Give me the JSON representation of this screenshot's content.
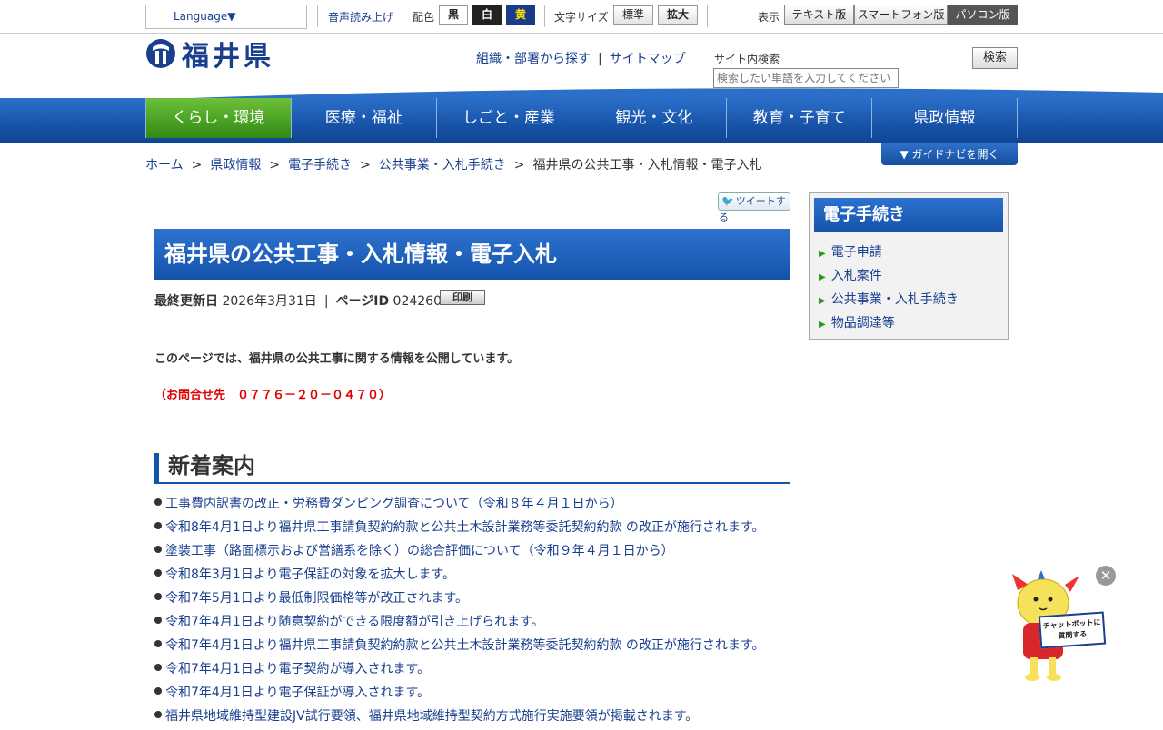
{
  "topbar": {
    "language": "Language▼",
    "read_aloud": "音声読み上げ",
    "color_label": "配色",
    "color_black": "黒",
    "color_white": "白",
    "color_yellow": "黄",
    "font_size_label": "文字サイズ",
    "font_standard": "標準",
    "font_large": "拡大",
    "display_label": "表示",
    "display_text": "テキスト版",
    "display_smartphone": "スマートフォン版",
    "display_pc": "パソコン版"
  },
  "header": {
    "logo_text": "福井県",
    "org_link": "組織・部署から探す",
    "separator": "|",
    "sitemap_link": "サイトマップ",
    "search_label": "サイト内検索",
    "search_placeholder": "検索したい単語を入力してください",
    "search_button": "検索"
  },
  "nav": [
    "くらし・環境",
    "医療・福祉",
    "しごと・産業",
    "観光・文化",
    "教育・子育て",
    "県政情報"
  ],
  "guide_button": "▼ ガイドナビを開く",
  "breadcrumb": [
    "ホーム",
    "県政情報",
    "電子手続き",
    "公共事業・入札手続き",
    "福井県の公共工事・入札情報・電子入札"
  ],
  "breadcrumb_sep": ">",
  "main": {
    "tweet": "ツイートする",
    "title": "福井県の公共工事・入札情報・電子入札",
    "updated_label": "最終更新日",
    "updated_value": "2026年3月31日",
    "meta_sep": "|",
    "page_id_label": "ページID",
    "page_id_value": "024260",
    "print_button": "印刷",
    "intro": "このページでは、福井県の公共工事に関する情報を公開しています。",
    "contact": "（お問合せ先　０７７６－２０－０４７０）",
    "section_heading": "新着案内",
    "news": [
      "工事費内訳書の改正・労務費ダンピング調査について（令和８年４月１日から）",
      "令和8年4月1日より福井県工事請負契約約款と公共土木設計業務等委託契約約款 の改正が施行されます。",
      "塗装工事（路面標示および営繕系を除く）の総合評価について（令和９年４月１日から）",
      "令和8年3月1日より電子保証の対象を拡大します。",
      "令和7年5月1日より最低制限価格等が改正されます。",
      "令和7年4月1日より随意契約ができる限度額が引き上げられます。",
      "令和7年4月1日より福井県工事請負契約約款と公共土木設計業務等委託契約約款 の改正が施行されます。",
      "令和7年4月1日より電子契約が導入されます。",
      "令和7年4月1日より電子保証が導入されます。",
      "福井県地域維持型建設JV試行要領、福井県地域維持型契約方式施行実施要領が掲載されます。"
    ]
  },
  "side": {
    "title": "電子手続き",
    "items": [
      "電子申請",
      "入札案件",
      "公共事業・入札手続き",
      "物品調達等"
    ]
  },
  "chatbot": {
    "close": "✕",
    "label_line1": "チャットボットに",
    "label_line2": "質問する"
  },
  "colors": {
    "brand_blue": "#1553ab",
    "active_green": "#2f8a14",
    "link": "#1a3f8f",
    "contact_red": "#e00000"
  }
}
